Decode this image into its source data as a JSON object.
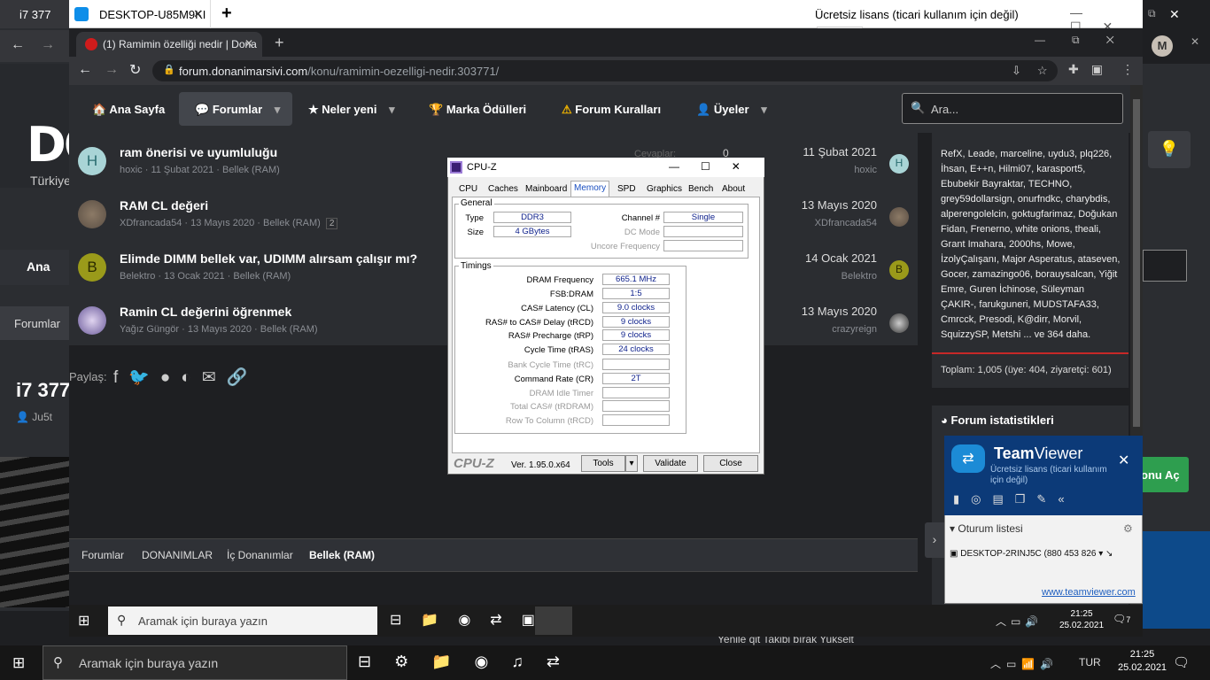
{
  "host": {
    "tab_title": "i7 377",
    "logo": "DO",
    "logo_sub": "Türkiye",
    "nav_ana": "Ana",
    "nav_forumlar": "Forumlar",
    "thread_title": "i7 377",
    "thread_user": "Ju5t",
    "avatar_letter": "M",
    "behind_buttons": "Yenile qit    Takibi bırak    Yukselt"
  },
  "teamviewer_window": {
    "tab_title": "DESKTOP-U85M9KI",
    "license_text": "Ücretsiz lisans (ticari kullanım için değil)"
  },
  "browser": {
    "tab_title": "(1) Ramimin özelliği nedir | Dona",
    "url_domain": "forum.donanimarsivi.com",
    "url_path": "/konu/ramimin-oezelligi-nedir.303771/"
  },
  "forum_nav": {
    "items": [
      "Ana Sayfa",
      "Forumlar",
      "Neler yeni",
      "Marka Ödülleri",
      "Forum Kuralları",
      "Üyeler"
    ],
    "search_placeholder": "Ara..."
  },
  "threads": [
    {
      "avatar": "H",
      "title": "ram önerisi ve uyumluluğu",
      "meta": "hoxic · 11 Şubat 2021 · Bellek (RAM)",
      "date": "11 Şubat 2021",
      "last_user": "hoxic",
      "small_avatar": "H",
      "replies_label": "Cevaplar:",
      "replies": "0"
    },
    {
      "avatar": "",
      "title": "RAM CL değeri",
      "meta": "XDfrancada54 · 13 Mayıs 2020 · Bellek (RAM)",
      "page": "2",
      "date": "13 Mayıs 2020",
      "last_user": "XDfrancada54",
      "small_avatar": ""
    },
    {
      "avatar": "B",
      "title": "Elimde DIMM bellek var, UDIMM alırsam çalışır mı?",
      "meta": "Belektro · 13 Ocak 2021 · Bellek (RAM)",
      "date": "14 Ocak 2021",
      "last_user": "Belektro",
      "small_avatar": "B"
    },
    {
      "avatar": "",
      "title": "Ramin CL değerini öğrenmek",
      "meta": "Yağız Güngör · 13 Mayıs 2020 · Bellek (RAM)",
      "date": "13 Mayıs 2020",
      "last_user": "crazyreign",
      "small_avatar": ""
    }
  ],
  "share_label": "Paylaş:",
  "breadcrumb": [
    "Forumlar",
    "DONANIMLAR",
    "İç Donanımlar",
    "Bellek (RAM)"
  ],
  "sidebar": {
    "online_users": "RefX, Leade, marceline, uydu3, plq226, İhsan, E++n, Hilmi07, karasport5, Ebubekir Bayraktar, TECHNO, grey59dollarsign, onurfndkc, charybdis, alperengolelcin, goktugfarimaz, Doğukan Fidan, Frenerno, white onions, theali, Grant Imahara, 2000hs, Mowe, İzolyÇalışanı, Major Asperatus, ataseven, Gocer, zamazingo06, borauysalcan, Yiğit Emre, Guren İchinose, Süleyman ÇAKIR-, farukguneri, MUDSTAFA33, Cmrcck, Presodi, K@dirr, Morvil, SquizzySP, Metshi ... ve 364 daha.",
    "total": "Toplam: 1,005 (üye: 404, ziyaretçi: 601)",
    "stats_title": "Forum istatistikleri",
    "green_button": "onu Aç"
  },
  "teamviewer_panel": {
    "brand_bold": "Team",
    "brand_light": "Viewer",
    "subtitle": "Ücretsiz lisans (ticari kullanım için değil)",
    "session_list_title": "Oturum listesi",
    "session_row": "DESKTOP-2RINJ5C (880 453 826",
    "link": "www.teamviewer.com"
  },
  "cpuz": {
    "title": "CPU-Z",
    "tabs": [
      "CPU",
      "Caches",
      "Mainboard",
      "Memory",
      "SPD",
      "Graphics",
      "Bench",
      "About"
    ],
    "general_label": "General",
    "type_label": "Type",
    "type": "DDR3",
    "size_label": "Size",
    "size": "4 GBytes",
    "channel_label": "Channel #",
    "channel": "Single",
    "dc_mode_label": "DC Mode",
    "uncore_label": "Uncore Frequency",
    "timings_label": "Timings",
    "dram_freq_label": "DRAM Frequency",
    "dram_freq": "665.1 MHz",
    "fsb_label": "FSB:DRAM",
    "fsb": "1:5",
    "cas_label": "CAS# Latency (CL)",
    "cas": "9.0 clocks",
    "rcd_label": "RAS# to CAS# Delay (tRCD)",
    "rcd": "9 clocks",
    "rp_label": "RAS# Precharge (tRP)",
    "rp": "9 clocks",
    "ras_label": "Cycle Time (tRAS)",
    "ras": "24 clocks",
    "trc_label": "Bank Cycle Time (tRC)",
    "cr_label": "Command Rate (CR)",
    "cr": "2T",
    "idle_label": "DRAM Idle Timer",
    "trdram_label": "Total CAS# (tRDRAM)",
    "trcd2_label": "Row To Column (tRCD)",
    "logo": "CPU-Z",
    "version": "Ver. 1.95.0.x64",
    "tools_btn": "Tools",
    "validate_btn": "Validate",
    "close_btn": "Close"
  },
  "remote_taskbar": {
    "search": "Aramak için buraya yazın",
    "time": "21:25",
    "date": "25.02.2021",
    "notif": "7"
  },
  "local_taskbar": {
    "search": "Aramak için buraya yazın",
    "lang": "TUR",
    "time": "21:25",
    "date": "25.02.2021"
  }
}
